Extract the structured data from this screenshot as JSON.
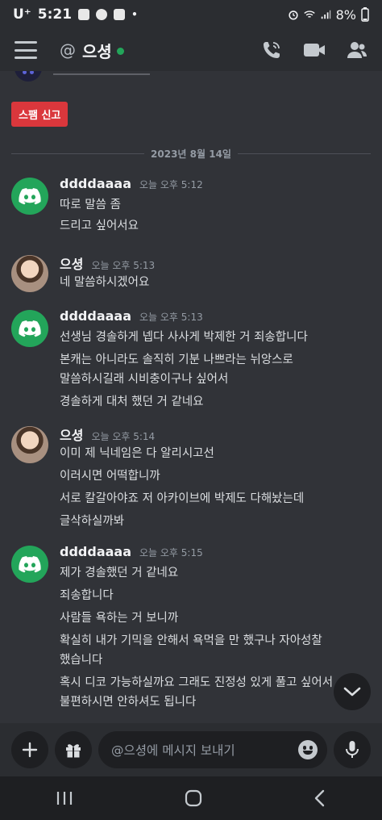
{
  "status_bar": {
    "carrier": "U⁺",
    "time": "5:21",
    "dot": "•",
    "battery": "8%"
  },
  "header": {
    "at_symbol": "@",
    "channel_name": "으셩",
    "status_color": "#23a55a"
  },
  "spam_report_button": "스팸 신고",
  "date_separator": "2023년 8월 14일",
  "messages": [
    {
      "username": "ddddaaaa",
      "timestamp": "오늘 오후 5:12",
      "avatar": "discord-logo",
      "lines": [
        "따로 말씀 좀",
        "드리고 싶어서요"
      ]
    },
    {
      "username": "으셩",
      "timestamp": "오늘 오후 5:13",
      "avatar": "profile-photo",
      "lines": [
        "네 말씀하시겠어요"
      ]
    },
    {
      "username": "ddddaaaa",
      "timestamp": "오늘 오후 5:13",
      "avatar": "discord-logo",
      "lines": [
        "선생님 경솔하게 넵다 사사게 박제한 거 죄송합니다",
        "본캐는 아니라도 솔직히 기분 나쁘라는 뉘앙스로",
        "말씀하시길래 시비충이구나 싶어서",
        "경솔하게 대처 했던 거 같네요"
      ]
    },
    {
      "username": "으셩",
      "timestamp": "오늘 오후 5:14",
      "avatar": "profile-photo",
      "lines": [
        "이미 제 닉네임은 다 알리시고선",
        "이러시면 어떡합니까",
        "서로 칼갈아야죠 저 아카이브에 박제도 다해놨는데",
        "글삭하실까봐"
      ]
    },
    {
      "username": "ddddaaaa",
      "timestamp": "오늘 오후 5:15",
      "avatar": "discord-logo",
      "lines": [
        "제가 경솔했던 거 같네요",
        "죄송합니다",
        "사람들 욕하는 거 보니까",
        "확실히 내가 기믹을 안해서 욕먹을 만 했구나 자아성찰",
        "했습니다",
        "혹시 디코 가능하실까요 그래도 진정성 있게 풀고 싶어서",
        "불편하시면 안하셔도 됩니다"
      ]
    }
  ],
  "input": {
    "placeholder": "@으셩에 메시지 보내기"
  },
  "colors": {
    "background": "#313338",
    "header": "#2b2d31",
    "spam": "#da373c",
    "discord_avatar": "#23a55a"
  }
}
